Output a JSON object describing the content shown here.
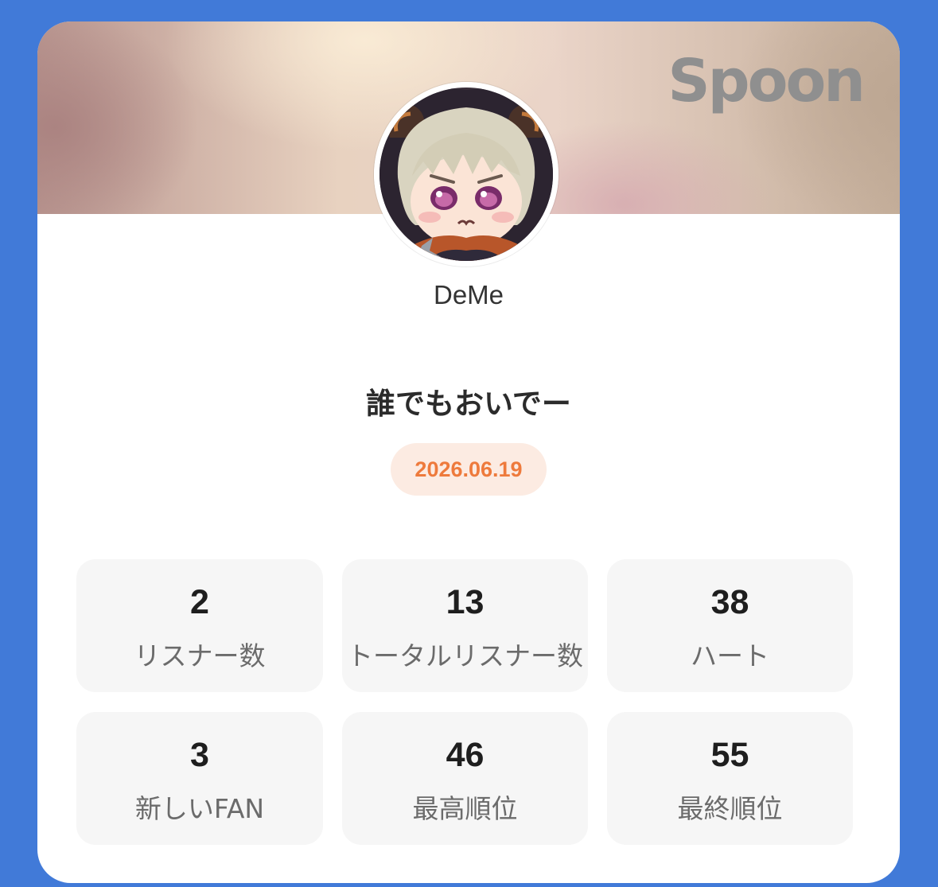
{
  "brand": {
    "logo_text": "Spoon"
  },
  "profile": {
    "username": "DeMe",
    "avatar_icon": "anime-character-avatar"
  },
  "live": {
    "title": "誰でもおいでー",
    "date": "2026.06.19"
  },
  "colors": {
    "background": "#417ad8",
    "accent": "#ee7a3c",
    "date_pill_bg": "#fcebe2",
    "stat_bg": "#f6f6f6"
  },
  "stats": [
    {
      "value": "2",
      "label": "リスナー数"
    },
    {
      "value": "13",
      "label": "トータルリスナー数"
    },
    {
      "value": "38",
      "label": "ハート"
    },
    {
      "value": "3",
      "label": "新しいFAN"
    },
    {
      "value": "46",
      "label": "最高順位"
    },
    {
      "value": "55",
      "label": "最終順位"
    }
  ]
}
